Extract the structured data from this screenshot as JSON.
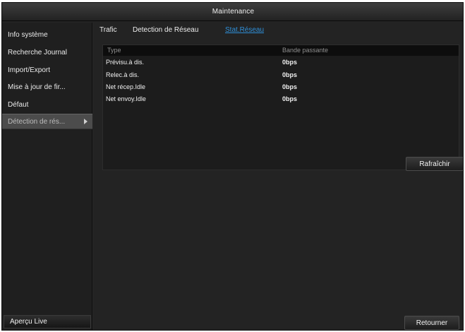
{
  "window": {
    "title": "Maintenance"
  },
  "sidebar": {
    "items": [
      {
        "label": "Info système"
      },
      {
        "label": "Recherche Journal"
      },
      {
        "label": "Import/Export"
      },
      {
        "label": "Mise à jour de fir..."
      },
      {
        "label": "Défaut"
      },
      {
        "label": "Détection de rés..."
      }
    ],
    "live_button": "Aperçu Live"
  },
  "tabs": [
    {
      "label": "Trafic"
    },
    {
      "label": "Detection de Réseau"
    },
    {
      "label": "Stat.Réseau"
    }
  ],
  "table": {
    "headers": [
      "Type",
      "Bande passante"
    ],
    "rows": [
      {
        "type": "Prévisu.à dis.",
        "bandwidth": "0bps"
      },
      {
        "type": "Relec.à dis.",
        "bandwidth": "0bps"
      },
      {
        "type": "Net récep.Idle",
        "bandwidth": "0bps"
      },
      {
        "type": "Net envoy.Idle",
        "bandwidth": "0bps"
      }
    ]
  },
  "buttons": {
    "refresh": "Rafraîchir",
    "back": "Retourner"
  }
}
